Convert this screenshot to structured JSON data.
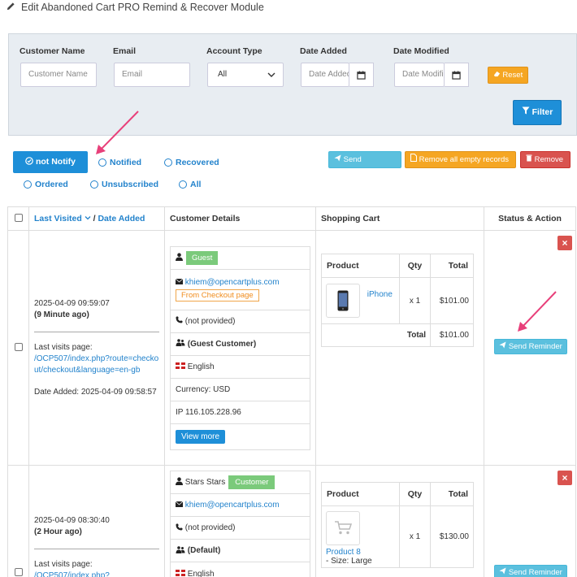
{
  "header": {
    "title": "Edit Abandoned Cart PRO Remind & Recover Module"
  },
  "filters": {
    "customer_name": {
      "label": "Customer Name",
      "placeholder": "Customer Name"
    },
    "email": {
      "label": "Email",
      "placeholder": "Email"
    },
    "account_type": {
      "label": "Account Type",
      "value": "All"
    },
    "date_added": {
      "label": "Date Added",
      "placeholder": "Date Added"
    },
    "date_modified": {
      "label": "Date Modified",
      "placeholder": "Date Modified"
    },
    "reset_label": "Reset",
    "filter_label": "Filter"
  },
  "status_filters": {
    "active": "not Notify",
    "options": [
      "Notified",
      "Recovered",
      "Ordered",
      "Unsubscribed",
      "All"
    ]
  },
  "actions": {
    "send_reminder": "Send Reminder",
    "remove_empty": "Remove all empty records",
    "remove": "Remove"
  },
  "table": {
    "col_last_visited": "Last Visited",
    "col_sep": "/",
    "col_date_added": "Date Added",
    "col_customer": "Customer Details",
    "col_cart": "Shopping Cart",
    "col_status": "Status & Action",
    "cart_headers": {
      "product": "Product",
      "qty": "Qty",
      "total": "Total"
    },
    "rows": [
      {
        "visited": "2025-04-09 09:59:07",
        "ago": "(9 Minute ago)",
        "last_page_label": "Last visits page:",
        "last_page_url": "/OCP507/index.php?route=checkout/checkout&language=en-gb",
        "date_added": "Date Added: 2025-04-09 09:58:57",
        "customer": {
          "name": "",
          "badge": "Guest",
          "email": "khiem@opencartplus.com",
          "source": "From Checkout page",
          "phone": "(not provided)",
          "group": "(Guest Customer)",
          "language": "English",
          "currency": "Currency: USD",
          "ip": "IP 116.105.228.96",
          "view_more": "View more"
        },
        "cart": {
          "product": "iPhone",
          "qty": "x 1",
          "price": "$101.00",
          "total_label": "Total",
          "total": "$101.00"
        },
        "send_label": "Send Reminder"
      },
      {
        "visited": "2025-04-09 08:30:40",
        "ago": "(2 Hour ago)",
        "last_page_label": "Last visits page:",
        "last_page_url": "/OCP507/index.php?",
        "customer": {
          "name": "Stars Stars",
          "badge": "Customer",
          "email": "khiem@opencartplus.com",
          "phone": "(not provided)",
          "group": "(Default)",
          "language": "English"
        },
        "cart": {
          "product": "Product 8",
          "option": "- Size: Large",
          "qty": "x 1",
          "price": "$130.00"
        },
        "send_label": "Send Reminder"
      }
    ]
  },
  "colors": {
    "primary": "#1e8fd8",
    "warning": "#f5a623",
    "danger": "#d9534f",
    "info": "#5bc0de",
    "success": "#7bca7b",
    "annotation": "#e8407a"
  }
}
